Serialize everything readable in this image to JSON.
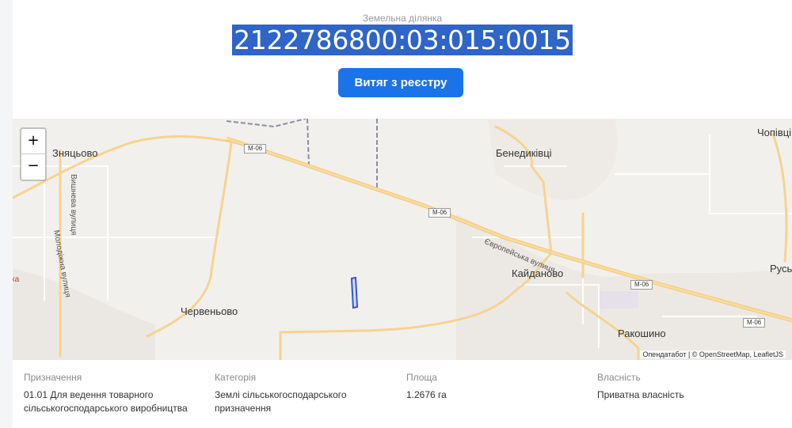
{
  "header": {
    "subtitle": "Земельна ділянка",
    "cadastral_number": "2122786800:03:015:0015",
    "extract_button": "Витяг з реєстру"
  },
  "map": {
    "zoom_in": "+",
    "zoom_out": "−",
    "places": [
      "Зняцьово",
      "Бенедиківці",
      "Чопівці",
      "Кайданово",
      "Червеньово",
      "Ракошино",
      "Русь"
    ],
    "place_partial_left": "ка",
    "road_shields": [
      "M-06",
      "M-06",
      "M-06",
      "M-06"
    ],
    "street_labels": [
      "Європейська вулиця",
      "Вишнева вулиця",
      "Молодіжна вулиця"
    ],
    "attribution": "Опендатабот | © OpenStreetMap, LeafletJS",
    "colors": {
      "background": "#f2f0ed",
      "major_road": "#f7d38f",
      "parcel_outline": "#2a4fd6"
    }
  },
  "details": [
    {
      "label": "Призначення",
      "value": "01.01 Для ведення товарного сільськогосподарського виробництва"
    },
    {
      "label": "Категорія",
      "value": "Землі сільськогосподарського призначення"
    },
    {
      "label": "Площа",
      "value": "1.2676 га"
    },
    {
      "label": "Власність",
      "value": "Приватна власність"
    }
  ]
}
